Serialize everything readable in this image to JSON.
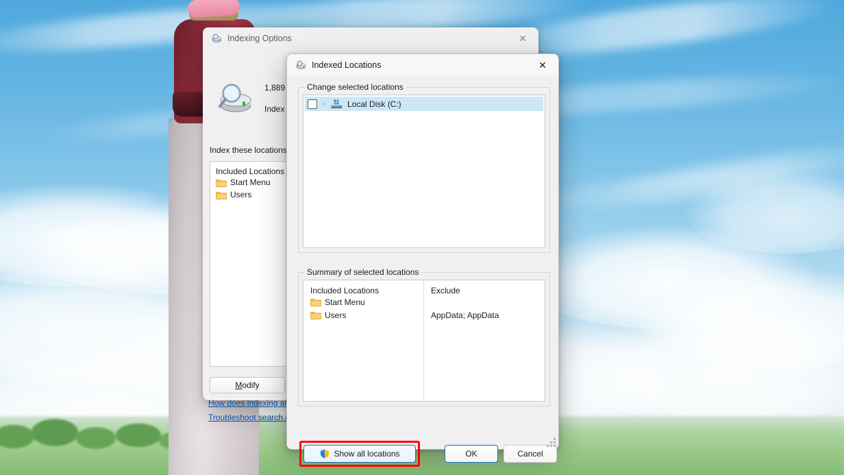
{
  "desktop": {
    "wallpaper_name": "sky-field-character-wallpaper"
  },
  "indexing_options_window": {
    "title": "Indexing Options",
    "icon": "indexing-magnifier-disk-icon",
    "close_label": "✕",
    "items_indexed_count": "1,889",
    "index_status_partial": "Index",
    "locations_label": "Index these locations:",
    "list_header": "Included Locations",
    "locations": [
      {
        "name": "Start Menu",
        "icon": "folder-icon"
      },
      {
        "name": "Users",
        "icon": "folder-icon"
      }
    ],
    "modify_button": {
      "accel": "M",
      "rest": "odify"
    },
    "links": [
      "How does indexing affe",
      "Troubleshoot search an"
    ]
  },
  "indexed_locations_dialog": {
    "title": "Indexed Locations",
    "icon": "indexing-magnifier-disk-icon",
    "close_label": "✕",
    "change_group_label": "Change selected locations",
    "tree": [
      {
        "label": "Local Disk (C:)",
        "icon": "hard-drive-icon",
        "checked": false,
        "expander": "›",
        "selected": true
      }
    ],
    "summary_group_label": "Summary of selected locations",
    "summary_columns": [
      "Included Locations",
      "Exclude"
    ],
    "summary_rows": [
      {
        "included": "Start Menu",
        "icon": "folder-icon",
        "exclude": ""
      },
      {
        "included": "Users",
        "icon": "folder-icon",
        "exclude": "AppData; AppData"
      }
    ],
    "buttons": {
      "show_all_locations": "Show all locations",
      "show_all_locations_icon": "uac-shield-icon",
      "ok": "OK",
      "cancel": "Cancel"
    },
    "highlight_color": "#ff0000",
    "accent_color": "#1a6fc4",
    "selection_color": "#cce8f7"
  }
}
